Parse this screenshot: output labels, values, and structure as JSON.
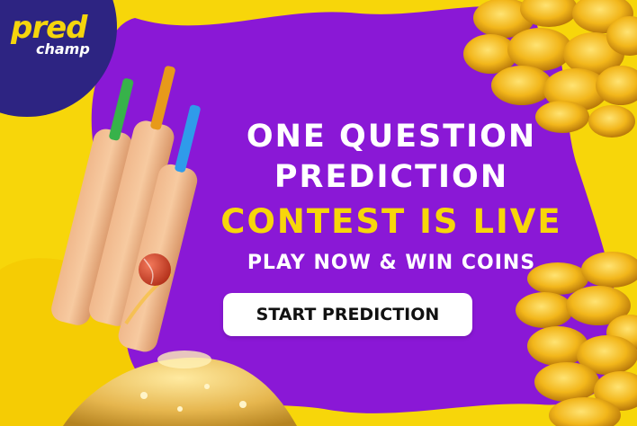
{
  "brand": {
    "logo_main": "pred",
    "logo_sub": "champ"
  },
  "banner": {
    "line1": "ONE QUESTION",
    "line2": "PREDICTION",
    "line3": "CONTEST IS LIVE",
    "line4": "PLAY NOW & WIN COINS",
    "cta_label": "START PREDICTION"
  },
  "colors": {
    "yellow": "#f7d60a",
    "purple": "#8a18d6",
    "navy": "#2d2482",
    "white": "#ffffff"
  },
  "icons": [
    "cricket-bat-icon",
    "cricket-ball-icon",
    "gold-coins-icon",
    "trophy-pile-icon"
  ]
}
